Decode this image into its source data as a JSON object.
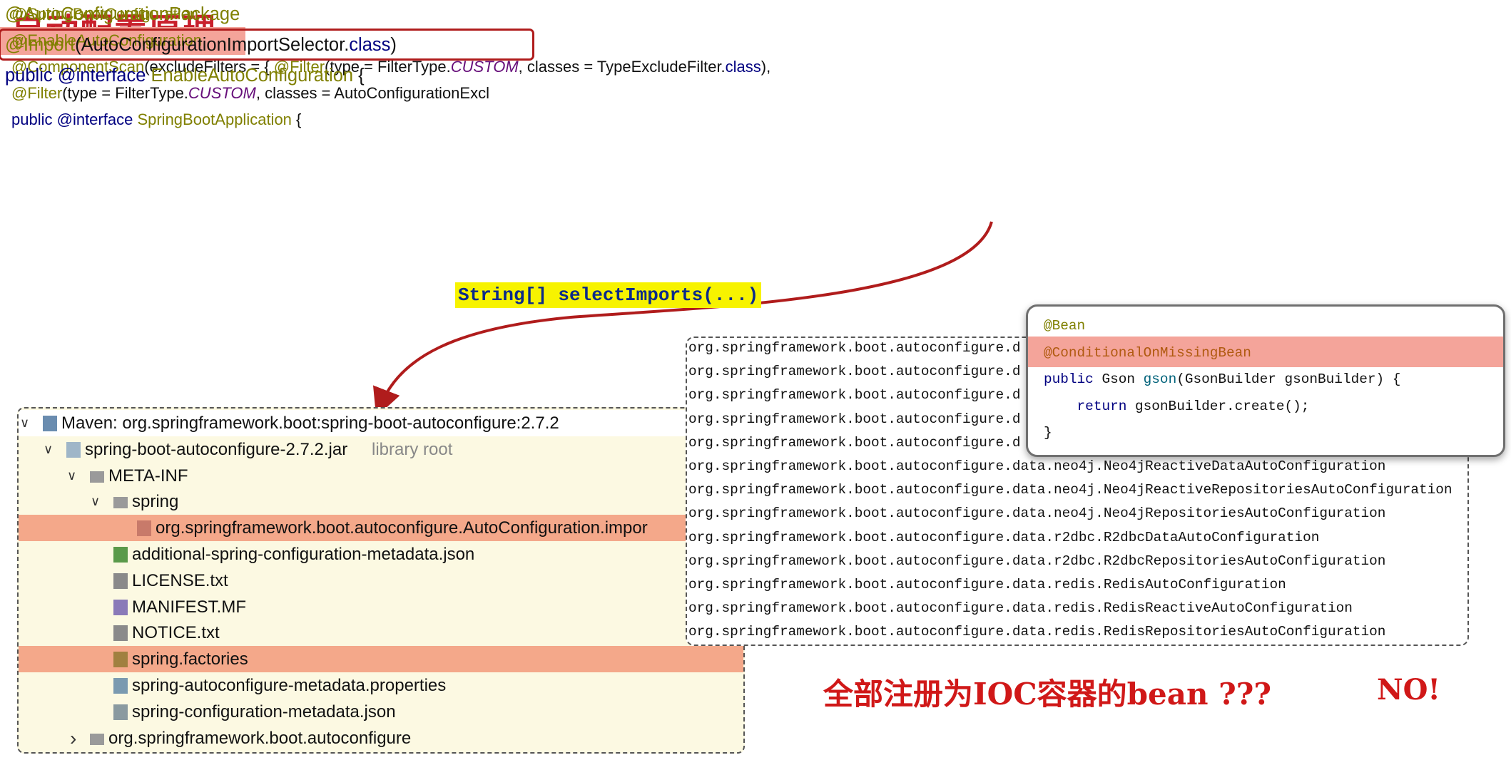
{
  "title": "自动配置原理",
  "spring_boot_application": {
    "lines": [
      [
        {
          "t": "@SpringBootConfiguration",
          "k": "ann"
        }
      ],
      [
        {
          "t": "@EnableAutoConfiguration",
          "k": "ann"
        }
      ],
      [
        {
          "t": "@ComponentScan",
          "k": "ann"
        },
        {
          "t": "(excludeFilters = { ",
          "k": "plain"
        },
        {
          "t": "@Filter",
          "k": "ann"
        },
        {
          "t": "(type = FilterType.",
          "k": "plain"
        },
        {
          "t": "CUSTOM",
          "k": "const"
        },
        {
          "t": ", classes = TypeExcludeFilter.",
          "k": "plain"
        },
        {
          "t": "class",
          "k": "kw"
        },
        {
          "t": "),",
          "k": "plain"
        }
      ],
      [
        {
          "t": "        ",
          "k": "plain"
        },
        {
          "t": "@Filter",
          "k": "ann"
        },
        {
          "t": "(type = FilterType.",
          "k": "plain"
        },
        {
          "t": "CUSTOM",
          "k": "const"
        },
        {
          "t": ", classes = AutoConfigurationExcl",
          "k": "plain"
        }
      ],
      [
        {
          "t": "public",
          "k": "kw"
        },
        {
          "t": " ",
          "k": "plain"
        },
        {
          "t": "@interface",
          "k": "kw"
        },
        {
          "t": " SpringBootApplication",
          "k": "ann"
        },
        {
          "t": " {",
          "k": "plain"
        }
      ]
    ],
    "highlighted_line": 1
  },
  "enable_auto_configuration": {
    "lines": [
      [
        {
          "t": "@AutoConfigurationPackage",
          "k": "ann"
        }
      ],
      [
        {
          "t": "@Import",
          "k": "ann"
        },
        {
          "t": "(AutoConfigurationImportSelector.",
          "k": "plain"
        },
        {
          "t": "class",
          "k": "kw"
        },
        {
          "t": ")",
          "k": "plain"
        }
      ],
      [
        {
          "t": "public",
          "k": "kw"
        },
        {
          "t": " ",
          "k": "plain"
        },
        {
          "t": "@interface",
          "k": "kw"
        },
        {
          "t": " EnableAutoConfiguration",
          "k": "ann"
        },
        {
          "t": " {",
          "k": "plain"
        }
      ]
    ],
    "boxed_line": 1
  },
  "select_imports_label": "String[] selectImports(...)",
  "tree": [
    {
      "label": "Maven: org.springframework.boot:spring-boot-autoconfigure:2.7.2",
      "icon": "maven-library-icon",
      "chev": "expanded",
      "level": 0
    },
    {
      "label": "spring-boot-autoconfigure-2.7.2.jar",
      "extra": "library root",
      "icon": "jar-icon",
      "chev": "expanded",
      "level": 1
    },
    {
      "label": "META-INF",
      "icon": "folder-icon",
      "chev": "expanded",
      "level": 2
    },
    {
      "label": "spring",
      "icon": "folder-icon",
      "chev": "expanded",
      "level": 3
    },
    {
      "label": "org.springframework.boot.autoconfigure.AutoConfiguration.impor",
      "icon": "imports-file-icon",
      "level": 4,
      "highlight": true
    },
    {
      "label": "additional-spring-configuration-metadata.json",
      "icon": "json-config-file-icon",
      "level": 3
    },
    {
      "label": "LICENSE.txt",
      "icon": "text-file-icon",
      "level": 3
    },
    {
      "label": "MANIFEST.MF",
      "icon": "manifest-file-icon",
      "level": 3
    },
    {
      "label": "NOTICE.txt",
      "icon": "text-file-icon",
      "level": 3
    },
    {
      "label": "spring.factories",
      "icon": "spring-factories-icon",
      "level": 3,
      "highlight": true
    },
    {
      "label": "spring-autoconfigure-metadata.properties",
      "icon": "properties-file-icon",
      "level": 3
    },
    {
      "label": "spring-configuration-metadata.json",
      "icon": "json-file-icon",
      "level": 3
    },
    {
      "label": "org.springframework.boot.autoconfigure",
      "icon": "folder-icon",
      "chev": "collapsed",
      "level": 2
    }
  ],
  "imports_list": [
    "org.springframework.boot.autoconfigure.d",
    "org.springframework.boot.autoconfigure.d",
    "org.springframework.boot.autoconfigure.d",
    "org.springframework.boot.autoconfigure.d",
    "org.springframework.boot.autoconfigure.d",
    "org.springframework.boot.autoconfigure.data.neo4j.Neo4jReactiveDataAutoConfiguration",
    "org.springframework.boot.autoconfigure.data.neo4j.Neo4jReactiveRepositoriesAutoConfiguration",
    "org.springframework.boot.autoconfigure.data.neo4j.Neo4jRepositoriesAutoConfiguration",
    "org.springframework.boot.autoconfigure.data.r2dbc.R2dbcDataAutoConfiguration",
    "org.springframework.boot.autoconfigure.data.r2dbc.R2dbcRepositoriesAutoConfiguration",
    "org.springframework.boot.autoconfigure.data.redis.RedisAutoConfiguration",
    "org.springframework.boot.autoconfigure.data.redis.RedisReactiveAutoConfiguration",
    "org.springframework.boot.autoconfigure.data.redis.RedisRepositoriesAutoConfiguration"
  ],
  "bean_popup": {
    "lines": [
      [
        {
          "t": "@Bean",
          "k": "ann"
        }
      ],
      [
        {
          "t": "@ConditionalOnMissingBean",
          "k": "orange"
        }
      ],
      [
        {
          "t": "public",
          "k": "kw"
        },
        {
          "t": " Gson ",
          "k": "plain"
        },
        {
          "t": "gson",
          "k": "fn"
        },
        {
          "t": "(GsonBuilder gsonBuilder) {",
          "k": "plain"
        }
      ],
      [
        {
          "t": "    ",
          "k": "plain"
        },
        {
          "t": "return",
          "k": "kw"
        },
        {
          "t": " gsonBuilder.create();",
          "k": "plain"
        }
      ],
      [
        {
          "t": "}",
          "k": "plain"
        }
      ]
    ],
    "highlighted_line": 1
  },
  "note": "全部注册为IOC容器的bean ???",
  "answer": "NO!",
  "colors": {
    "title": "#c8202c",
    "highlight": "#f4a88a",
    "arrow": "#b01c1c",
    "label_bg": "#f7f300",
    "tree_bg": "#fcf9e2"
  }
}
